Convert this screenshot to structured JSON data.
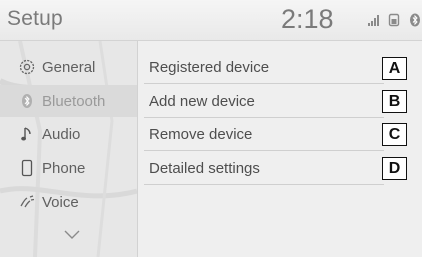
{
  "header": {
    "title": "Setup",
    "clock": "2:18",
    "status_icons": [
      "signal-bars-icon",
      "phone-battery-icon",
      "bluetooth-icon"
    ]
  },
  "sidebar": {
    "items": [
      {
        "label": "General",
        "icon": "gear-icon",
        "active": false
      },
      {
        "label": "Bluetooth",
        "icon": "bluetooth-icon",
        "active": true
      },
      {
        "label": "Audio",
        "icon": "music-note-icon",
        "active": false
      },
      {
        "label": "Phone",
        "icon": "phone-icon",
        "active": false
      },
      {
        "label": "Voice",
        "icon": "voice-icon",
        "active": false
      }
    ],
    "scroll_icon": "chevron-down-icon"
  },
  "main": {
    "items": [
      {
        "label": "Registered device",
        "callout": "A"
      },
      {
        "label": "Add new device",
        "callout": "B"
      },
      {
        "label": "Remove device",
        "callout": "C"
      },
      {
        "label": "Detailed settings",
        "callout": "D"
      }
    ]
  },
  "colors": {
    "background": "#efefef",
    "text": "#4e4e4e",
    "muted_text": "#7a7a7a",
    "active_row": "#dadada",
    "callout_border": "#111111"
  }
}
